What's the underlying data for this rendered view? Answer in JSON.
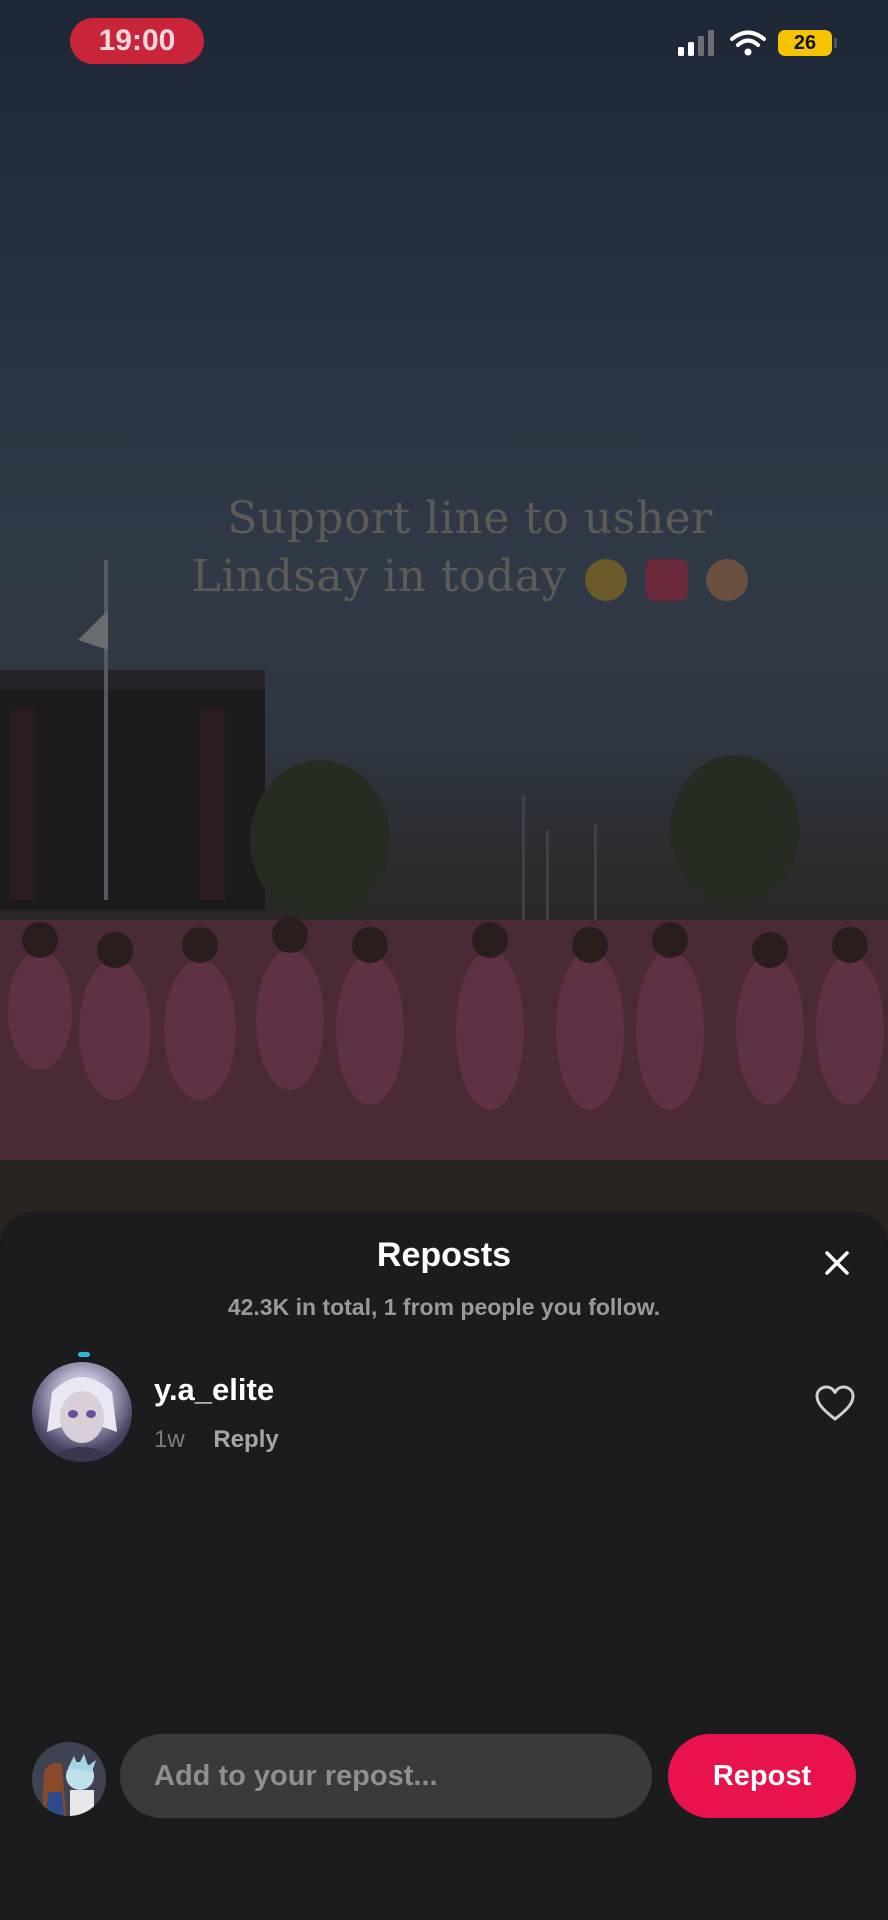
{
  "status_bar": {
    "time": "19:00",
    "battery": "26",
    "accent": "#c8253b"
  },
  "video": {
    "caption_line1": "Support line to usher",
    "caption_line2": "Lindsay in today"
  },
  "sheet": {
    "title": "Reposts",
    "subtitle": "42.3K in total, 1 from people you follow.",
    "close_icon": "close-icon"
  },
  "reposts": [
    {
      "username": "y.a_elite",
      "time": "1w",
      "reply_label": "Reply",
      "like_icon": "heart-outline-icon"
    }
  ],
  "composer": {
    "placeholder": "Add to your repost...",
    "button_label": "Repost",
    "button_color": "#e8124c"
  }
}
